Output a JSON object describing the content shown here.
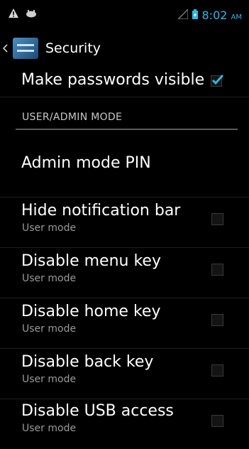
{
  "status_bar": {
    "time": "8:02",
    "ampm": "AM",
    "icons": [
      "warning-icon",
      "usb-icon",
      "signal-icon",
      "battery-icon"
    ]
  },
  "action_bar": {
    "title": "Security",
    "icon": "settings-icon"
  },
  "settings": {
    "make_passwords_visible": {
      "label": "Make passwords visible",
      "checked": true
    },
    "section_header": "USER/ADMIN MODE",
    "admin_pin": {
      "label": "Admin mode PIN"
    },
    "items": [
      {
        "label": "Hide notification bar",
        "summary": "User mode",
        "checked": false
      },
      {
        "label": "Disable menu key",
        "summary": "User mode",
        "checked": false
      },
      {
        "label": "Disable home key",
        "summary": "User mode",
        "checked": false
      },
      {
        "label": "Disable back key",
        "summary": "User mode",
        "checked": false
      },
      {
        "label": "Disable USB access",
        "summary": "User mode",
        "checked": false
      }
    ]
  },
  "colors": {
    "accent": "#33b5e5",
    "background": "#000000",
    "summary_text": "#9a9a9a"
  }
}
